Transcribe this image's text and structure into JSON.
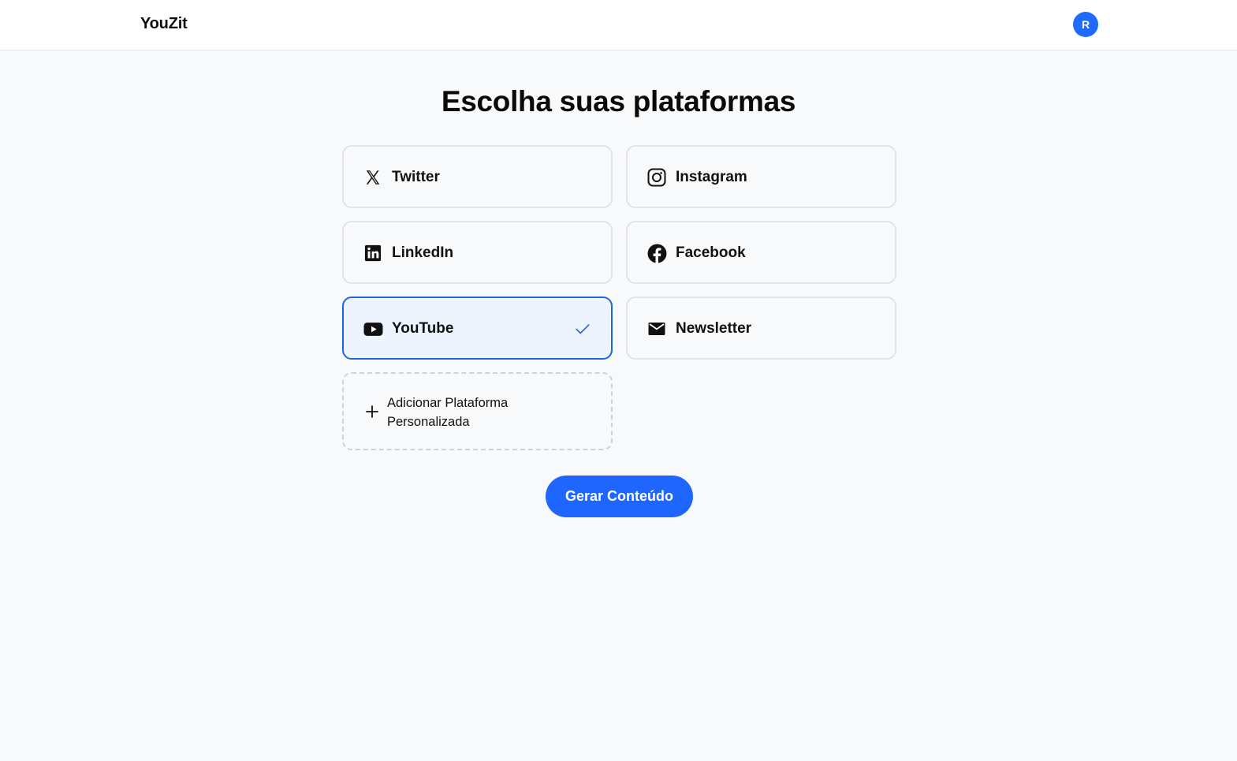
{
  "header": {
    "brand": "YouZit",
    "avatar_initial": "R"
  },
  "main": {
    "title": "Escolha suas plataformas",
    "platforms": [
      {
        "label": "Twitter",
        "icon": "x-twitter-icon",
        "selected": false
      },
      {
        "label": "Instagram",
        "icon": "instagram-icon",
        "selected": false
      },
      {
        "label": "LinkedIn",
        "icon": "linkedin-icon",
        "selected": false
      },
      {
        "label": "Facebook",
        "icon": "facebook-icon",
        "selected": false
      },
      {
        "label": "YouTube",
        "icon": "youtube-icon",
        "selected": true
      },
      {
        "label": "Newsletter",
        "icon": "envelope-icon",
        "selected": false
      }
    ],
    "add_custom_label": "Adicionar Plataforma Personalizada",
    "generate_button": "Gerar Conteúdo"
  },
  "colors": {
    "accent": "#1f66ff",
    "selected_border": "#1f66e0",
    "selected_background": "#edf4fe",
    "card_border": "#e2e4e8"
  }
}
